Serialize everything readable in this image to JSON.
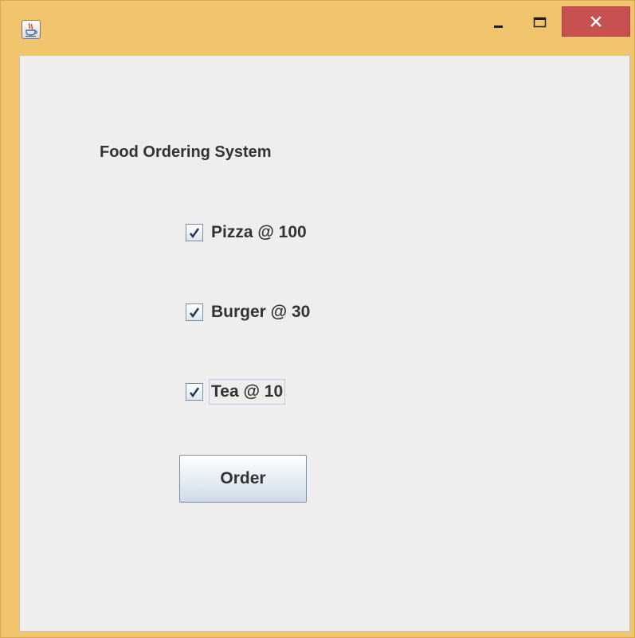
{
  "window": {
    "icon": "java-cup-icon",
    "controls": {
      "minimize_icon": "minimize-icon",
      "maximize_icon": "maximize-icon",
      "close_icon": "close-icon"
    },
    "colors": {
      "frame": "#f1c56e",
      "close_button": "#c75050",
      "content_background": "#eeeeee"
    }
  },
  "form": {
    "title": "Food Ordering System",
    "items": [
      {
        "label": "Pizza @ 100",
        "checked": true
      },
      {
        "label": "Burger @ 30",
        "checked": true
      },
      {
        "label": "Tea @ 10",
        "checked": true
      }
    ],
    "order_button": "Order"
  }
}
